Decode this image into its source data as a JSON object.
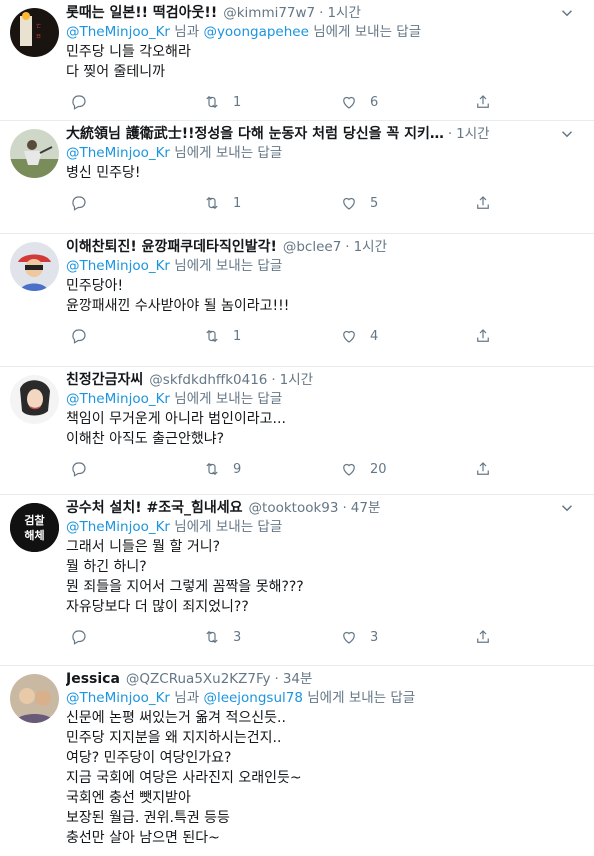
{
  "tweets": [
    {
      "name": "롯때는 일본!! 떡검아웃!!",
      "handle": "@kimmi77w7",
      "time": "1시간",
      "reply_prefix": "",
      "mentions": [
        "@TheMinjoo_Kr",
        "@yoongapehee"
      ],
      "joiner": "님과",
      "reply_suffix": "님에게 보내는 답글",
      "lines": [
        "민주당 니들 각오해라",
        "다 찢어 줄테니까"
      ],
      "reply_count": "",
      "retweet_count": "1",
      "like_count": "6"
    },
    {
      "name": "大統領님 護衛武士!!정성을 다해 눈동자 처럼 당신을 꼭 지키…",
      "handle": "",
      "time": "1시간",
      "mentions": [
        "@TheMinjoo_Kr"
      ],
      "joiner": "",
      "reply_suffix": "님에게 보내는 답글",
      "lines": [
        "병신 민주당!"
      ],
      "reply_count": "",
      "retweet_count": "1",
      "like_count": "5"
    },
    {
      "name": "이해찬퇴진! 윤깡패쿠데타직인발각!",
      "handle": "@bclee7",
      "time": "1시간",
      "mentions": [
        "@TheMinjoo_Kr"
      ],
      "joiner": "",
      "reply_suffix": "님에게 보내는 답글",
      "lines": [
        "민주당아!",
        "윤깡패새낀 수사받아야 될 놈이라고!!!"
      ],
      "reply_count": "",
      "retweet_count": "1",
      "like_count": "4"
    },
    {
      "name": "친정간금자씨",
      "handle": "@skfdkdhffk0416",
      "time": "1시간",
      "mentions": [
        "@TheMinjoo_Kr"
      ],
      "joiner": "",
      "reply_suffix": "님에게 보내는 답글",
      "lines": [
        "책임이 무거운게 아니라 범인이라고...",
        "이해찬 아직도 출근안했냐?"
      ],
      "reply_count": "",
      "retweet_count": "9",
      "like_count": "20"
    },
    {
      "name": "공수처 설치! #조국_힘내세요",
      "handle": "@tooktook93",
      "time": "47분",
      "avatar_text": [
        "검찰",
        "해체"
      ],
      "mentions": [
        "@TheMinjoo_Kr"
      ],
      "joiner": "",
      "reply_suffix": "님에게 보내는 답글",
      "lines": [
        "그래서 니들은 뭘 할 거니?",
        "뭘 하긴 하니?",
        "뭔 죄들을 지어서 그렇게 꼼짝을 못해???",
        "자유당보다 더 많이 죄지었니??"
      ],
      "reply_count": "",
      "retweet_count": "3",
      "like_count": "3"
    },
    {
      "name": "Jessica",
      "handle": "@QZCRua5Xu2KZ7Fy",
      "time": "34분",
      "mentions": [
        "@TheMinjoo_Kr",
        "@leejongsul78"
      ],
      "joiner": "님과",
      "reply_suffix": "님에게 보내는 답글",
      "lines": [
        "신문에 논평 써있는거 옮겨 적으신듯..",
        "민주당 지지분을 왜 지지하시는건지..",
        "여당? 민주당이 여당인가요?",
        "지금 국회에 여당은 사라진지 오래인듯~",
        "국회엔 충선 뺏지받아",
        "보장된 월급. 권위.특권 등등",
        "충선만 살아 남으면 된다~"
      ],
      "reply_count": "",
      "retweet_count": "",
      "like_count": ""
    }
  ],
  "colors": {
    "accent": "#1b95e0",
    "muted": "#657786",
    "text": "#14171a",
    "border": "#e6ecf0"
  },
  "icons": {
    "reply": "reply-icon",
    "retweet": "retweet-icon",
    "like": "heart-icon",
    "share": "share-icon",
    "more": "chevron-down-icon"
  }
}
